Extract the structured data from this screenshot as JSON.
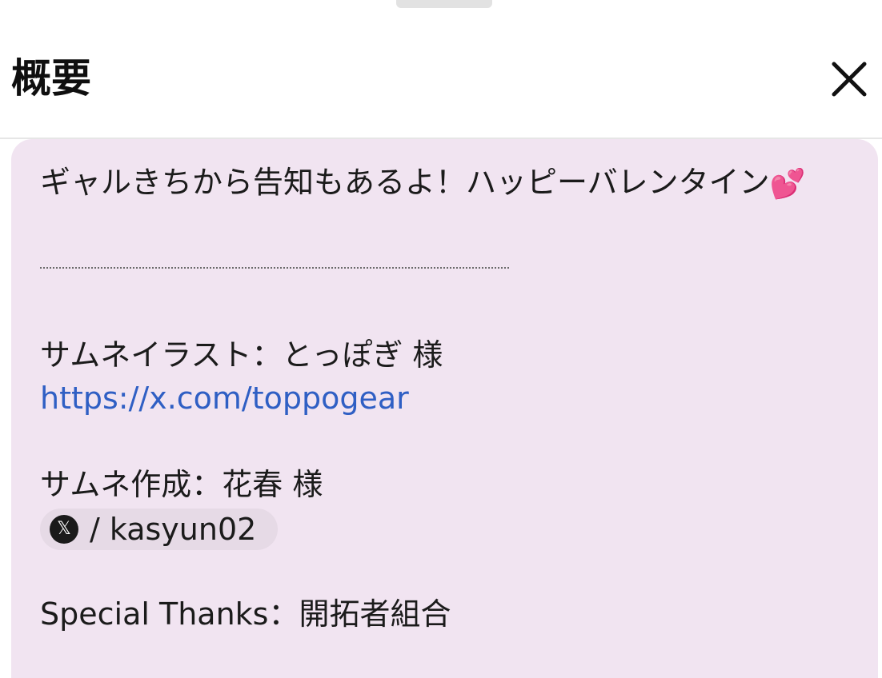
{
  "header": {
    "title": "概要",
    "close_icon": "close-icon"
  },
  "description": {
    "intro": "ギャルきちから告知もあるよ！ハッピーバレンタイン",
    "intro_emoji": "💕",
    "illustration_credit": "サムネイラスト：とっぽぎ 様",
    "illustration_link": "https://x.com/toppogear",
    "thumbnail_credit": "サムネ作成：花春 様",
    "thumbnail_chip": {
      "icon": "x-logo-icon",
      "text": "/ kasyun02"
    },
    "special_thanks": "Special Thanks：開拓者組合"
  },
  "colors": {
    "card_background": "#f1e4f1",
    "link": "#2f5fc4",
    "chip_background": "#e6dae6"
  }
}
